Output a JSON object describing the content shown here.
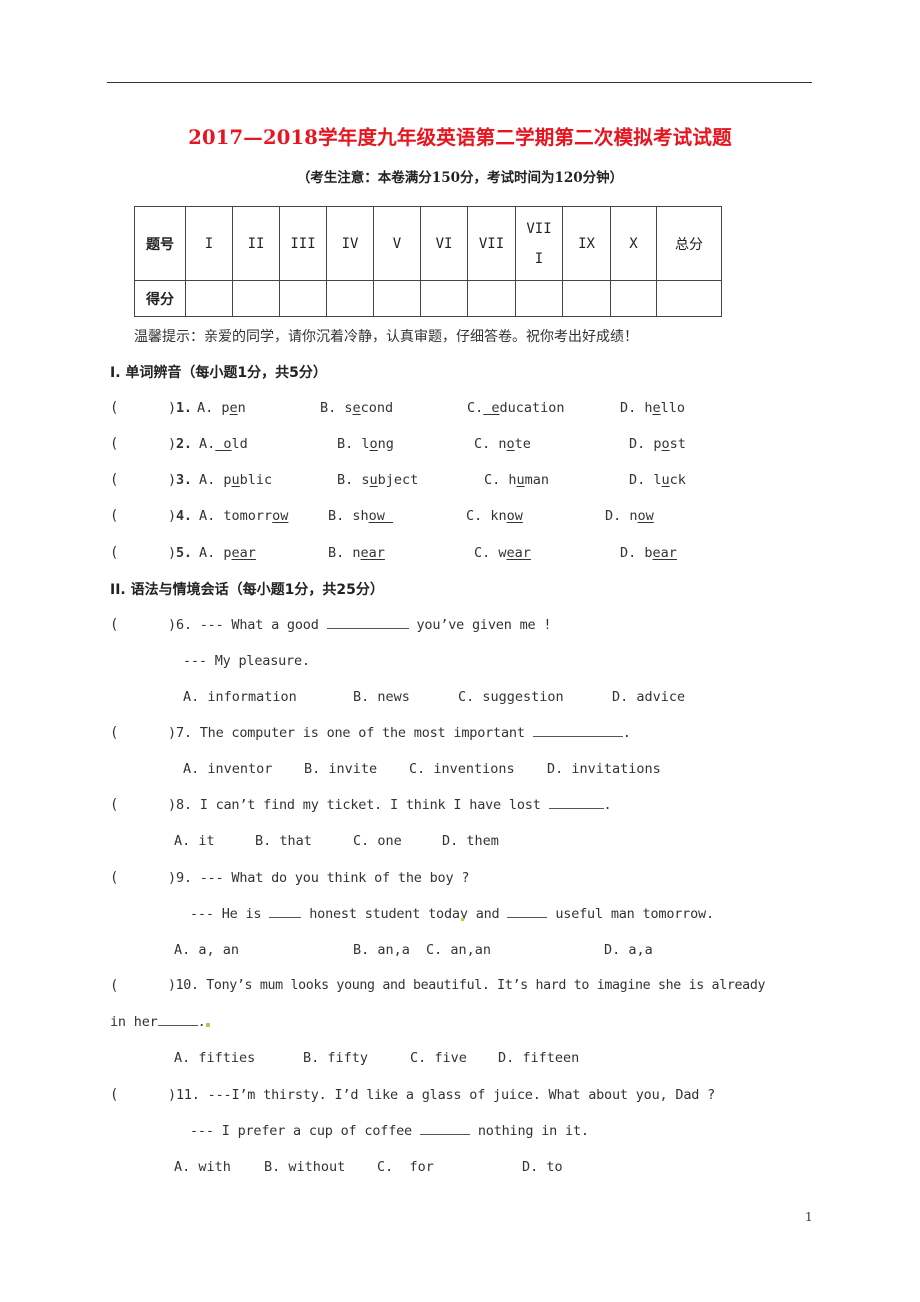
{
  "header": {
    "title": "2017—2018学年度九年级英语第二学期第二次模拟考试试题",
    "notice": "（考生注意：本卷满分150分，考试时间为120分钟）"
  },
  "score_table": {
    "row_labels": [
      "题号",
      "得分"
    ],
    "columns": [
      "I",
      "II",
      "III",
      "IV",
      "V",
      "VI",
      "VII",
      "VIII",
      "IX",
      "X",
      "总分"
    ],
    "column_display": [
      "I",
      "II",
      "III",
      "IV",
      "V",
      "VI",
      "VII",
      "VII\nI",
      "IX",
      "X",
      "总分"
    ],
    "scores": [
      "",
      "",
      "",
      "",
      "",
      "",
      "",
      "",
      "",
      "",
      ""
    ]
  },
  "tip": "温馨提示：亲爱的同学，请你沉着冷静，认真审题，仔细答卷。祝你考出好成绩！",
  "sections": [
    {
      "heading": "I. 单词辨音（每小题1分，共5分）",
      "questions": [
        {
          "num": "1.",
          "options": [
            {
              "label": "A.",
              "pre": "p",
              "ul": "e",
              "post": "n"
            },
            {
              "label": "B.",
              "pre": "s",
              "ul": "e",
              "post": "cond"
            },
            {
              "label": "C.",
              "pre": "",
              "ul": "_e",
              "post": "ducation"
            },
            {
              "label": "D.",
              "pre": "h",
              "ul": "e",
              "post": "llo"
            }
          ]
        },
        {
          "num": "2.",
          "options": [
            {
              "label": "A.",
              "pre": "",
              "ul": "_o",
              "post": "ld"
            },
            {
              "label": "B.",
              "pre": "l",
              "ul": "o",
              "post": "ng"
            },
            {
              "label": "C.",
              "pre": "n",
              "ul": "o",
              "post": "te"
            },
            {
              "label": "D.",
              "pre": "p",
              "ul": "o",
              "post": "st"
            }
          ]
        },
        {
          "num": "3.",
          "options": [
            {
              "label": "A.",
              "pre": "p",
              "ul": "u",
              "post": "blic"
            },
            {
              "label": "B.",
              "pre": "s",
              "ul": "u",
              "post": "bject"
            },
            {
              "label": "C.",
              "pre": "h",
              "ul": "u",
              "post": "man"
            },
            {
              "label": "D.",
              "pre": "l",
              "ul": "u",
              "post": "ck"
            }
          ]
        },
        {
          "num": "4.",
          "options": [
            {
              "label": "A.",
              "pre": "tomorr",
              "ul": "ow",
              "post": ""
            },
            {
              "label": "B.",
              "pre": "sh",
              "ul": "ow ",
              "post": ""
            },
            {
              "label": "C.",
              "pre": "kn",
              "ul": "ow",
              "post": ""
            },
            {
              "label": "D.",
              "pre": "n",
              "ul": "ow",
              "post": ""
            }
          ]
        },
        {
          "num": "5.",
          "options": [
            {
              "label": "A.",
              "pre": "p",
              "ul": "ear",
              "post": ""
            },
            {
              "label": "B.",
              "pre": "n",
              "ul": "ear",
              "post": ""
            },
            {
              "label": "C.",
              "pre": "w",
              "ul": "ear",
              "post": ""
            },
            {
              "label": "D.",
              "pre": "b",
              "ul": "ear",
              "post": ""
            }
          ]
        }
      ]
    },
    {
      "heading": "II. 语法与情境会话（每小题1分，共25分）",
      "questions": [
        {
          "num": "6.",
          "stem_a": " --- What a good ",
          "stem_b": " you’ve given me !",
          "reply": "--- My pleasure.",
          "options": [
            "A. information",
            "B. news",
            "C. suggestion",
            "D. advice"
          ]
        },
        {
          "num": "7.",
          "stem_a": " The computer is one of the most important ",
          "stem_b": ".",
          "options": [
            "A. inventor",
            "B. invite",
            "C. inventions",
            "D. invitations"
          ]
        },
        {
          "num": "8.",
          "stem_a": " I can’t find my ticket. I think I have lost ",
          "stem_b": ".",
          "options": [
            "A. it",
            "B. that",
            "C. one",
            "D. them"
          ]
        },
        {
          "num": "9.",
          "stem_a": " --- What do you think of the boy ?",
          "reply_a": "--- He is ",
          "reply_b": " honest student today and ",
          "reply_c": " useful man tomorrow.",
          "options": [
            "A. a, an",
            "B. an,a",
            "C. an,an",
            "D. a,a"
          ]
        },
        {
          "num": "10.",
          "stem_a": " Tony’s mum looks young and beautiful. It’s hard to imagine she is already",
          "stem_cont_a": "in her",
          "stem_cont_b": ".",
          "options": [
            "A. fifties",
            "B. fifty",
            "C. five",
            "D. fifteen"
          ]
        },
        {
          "num": "11.",
          "stem_a": " ---I’m thirsty. I’d like a glass of juice. What about you, Dad ?",
          "reply_a": "--- I prefer a cup of coffee ",
          "reply_b": " nothing in it.",
          "options": [
            "A. with",
            "B. without",
            "C.  for",
            "D. to"
          ]
        }
      ]
    }
  ],
  "answer_paren": "(",
  "answer_paren_close": ")",
  "page_number": "1"
}
